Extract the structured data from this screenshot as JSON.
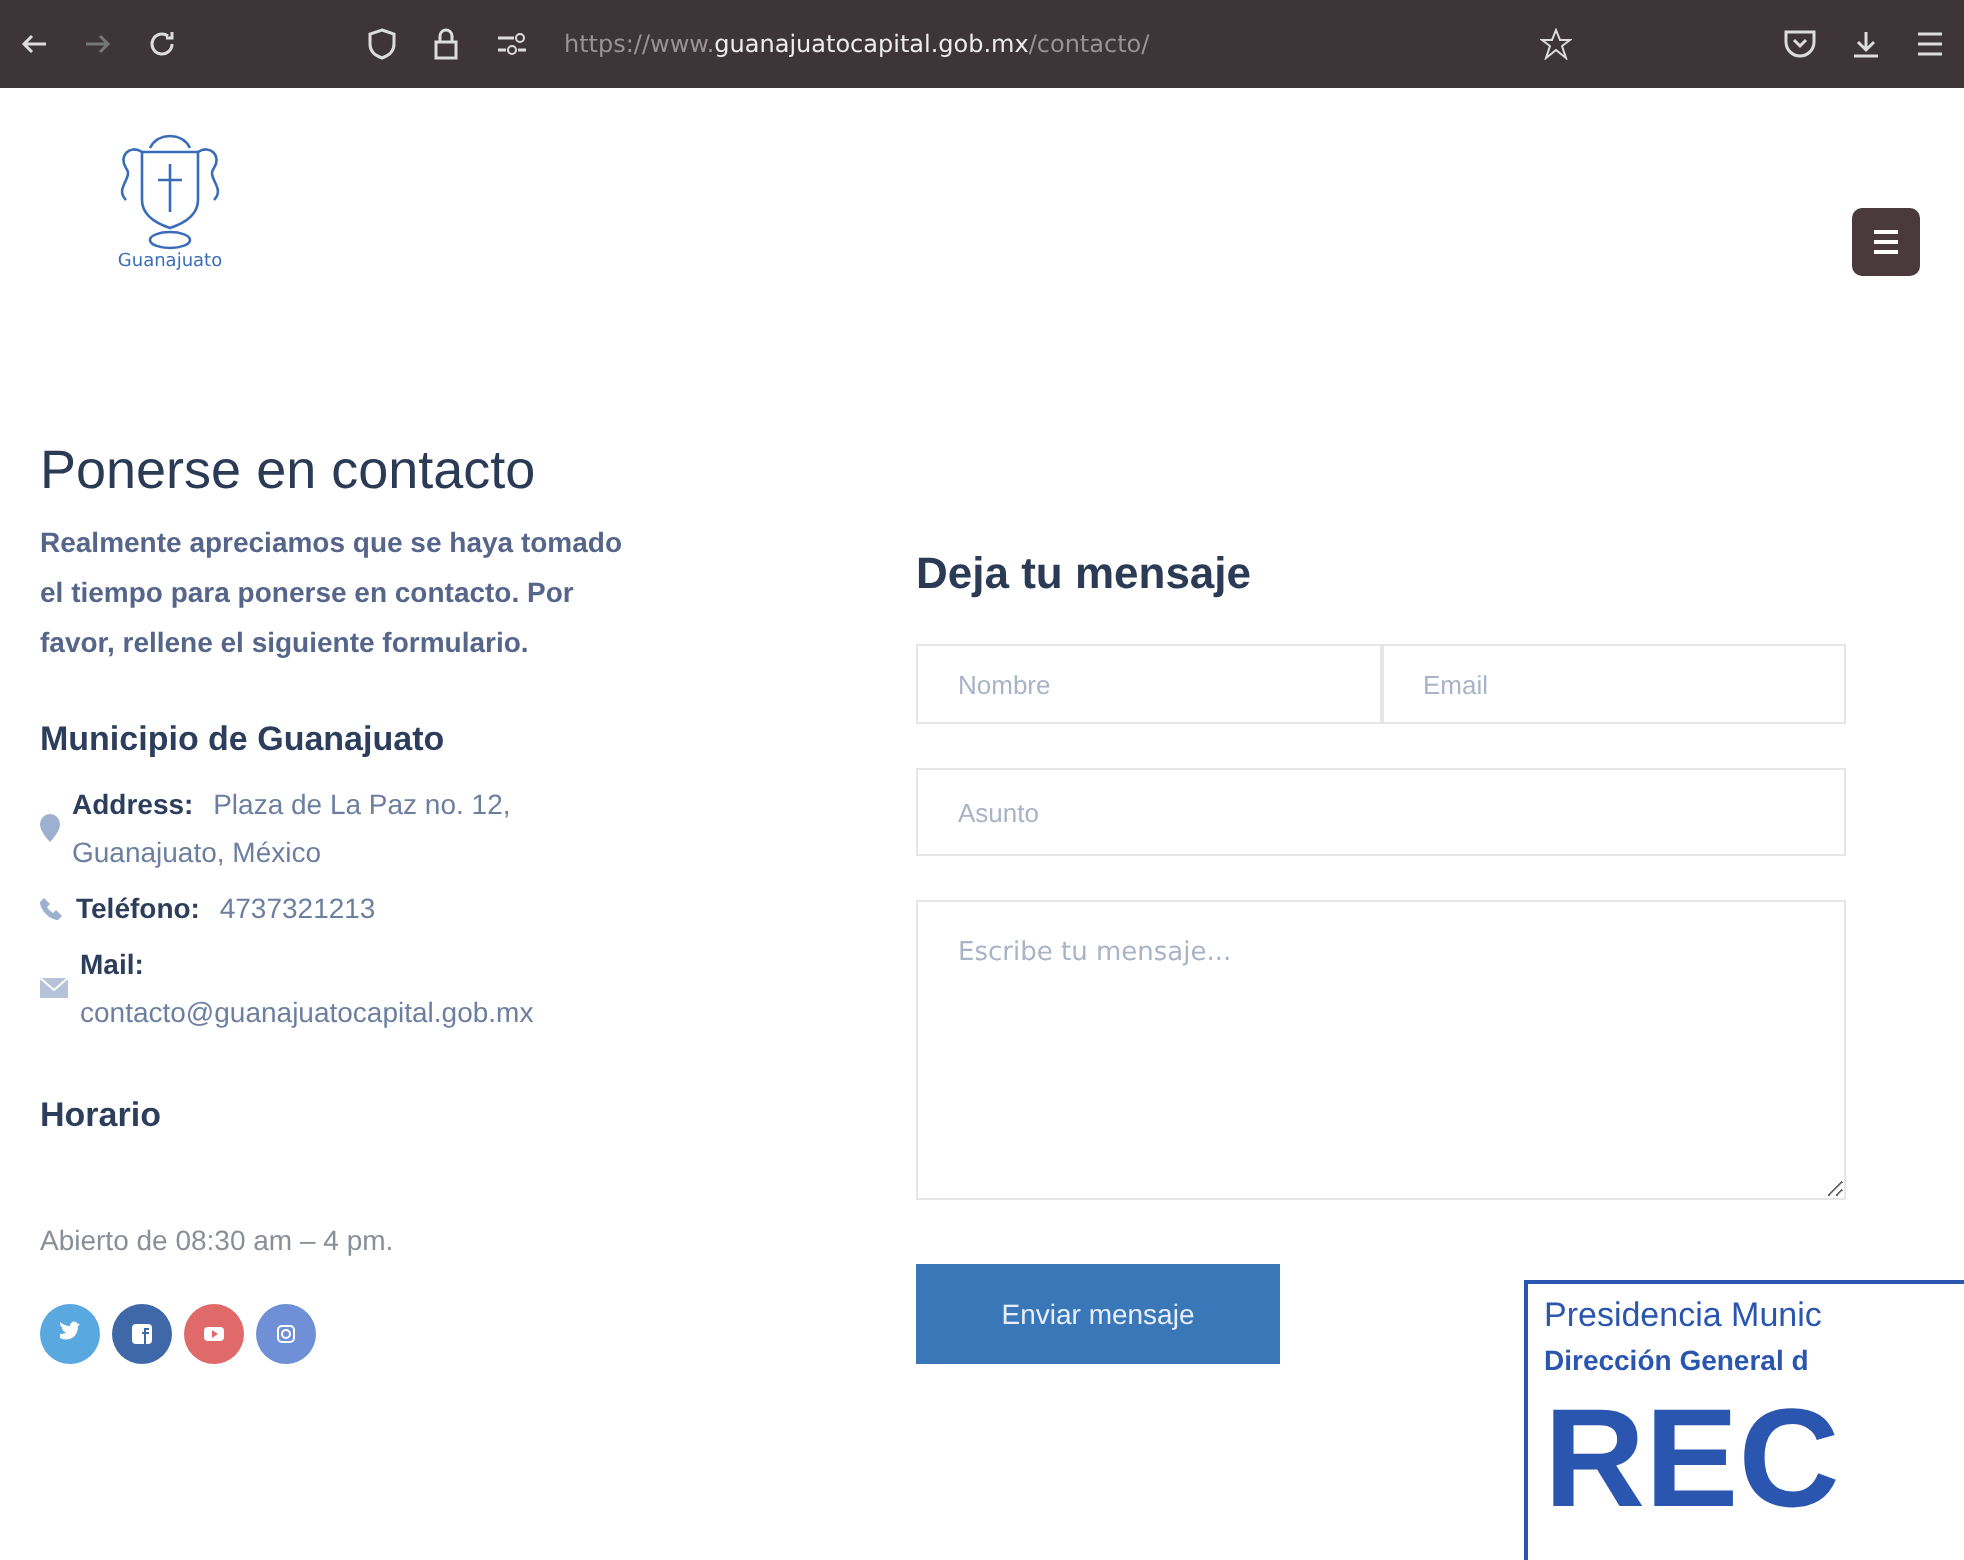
{
  "browser": {
    "url_prefix": "https://www.",
    "url_domain": "guanajuatocapital.gob.mx",
    "url_path": "/contacto/"
  },
  "logo": {
    "caption": "Guanajuato"
  },
  "contact": {
    "title": "Ponerse en contacto",
    "intro": "Realmente apreciamos que se haya tomado el tiempo para ponerse en contacto. Por favor, rellene el siguiente formulario.",
    "org": "Municipio de Guanajuato",
    "details": [
      {
        "kind": "address",
        "label": "Address:",
        "value": "Plaza de La Paz no. 12, Guanajuato, México"
      },
      {
        "kind": "phone",
        "label": "Teléfono:",
        "value": "4737321213"
      },
      {
        "kind": "mail",
        "label": "Mail:",
        "value": "contacto@guanajuatocapital.gob.mx"
      }
    ],
    "hours_title": "Horario",
    "hours": "Abierto de 08:30 am – 4 pm.",
    "social": [
      {
        "kind": "twitter",
        "color": "#5aa8e0"
      },
      {
        "kind": "facebook",
        "color": "#3f68a8"
      },
      {
        "kind": "youtube",
        "color": "#e06a6a"
      },
      {
        "kind": "instagram",
        "color": "#6f8fd6"
      }
    ]
  },
  "form": {
    "title": "Deja tu mensaje",
    "name_placeholder": "Nombre",
    "email_placeholder": "Email",
    "subject_placeholder": "Asunto",
    "message_placeholder": "Escribe tu mensaje...",
    "submit": "Enviar mensaje"
  },
  "stamp": {
    "line_1": "Presidencia Munic",
    "line_2": "Dirección General d",
    "big": "REC"
  }
}
